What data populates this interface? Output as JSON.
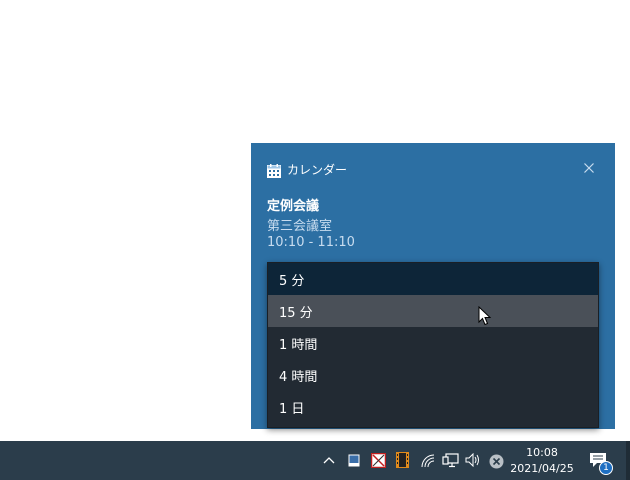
{
  "notification": {
    "app_name": "カレンダー",
    "title": "定例会議",
    "location": "第三会議室",
    "time": "10:10 - 11:10",
    "background_color": "#2c6fa3",
    "icons": {
      "app": "calendar-icon",
      "close": "close-icon"
    }
  },
  "snooze_dropdown": {
    "options": [
      "5 分",
      "15 分",
      "1 時間",
      "4 時間",
      "1 日"
    ],
    "selected": "5 分",
    "hovered": "15 分"
  },
  "taskbar": {
    "clock_time": "10:08",
    "clock_date": "2021/04/25",
    "notification_badge": "1",
    "tray_icons": [
      "chevron-up-icon",
      "tablet-icon",
      "image-tool-icon",
      "film-icon",
      "wifi-icon",
      "network-icon",
      "speaker-icon",
      "stop-icon",
      "action-center-icon"
    ]
  }
}
